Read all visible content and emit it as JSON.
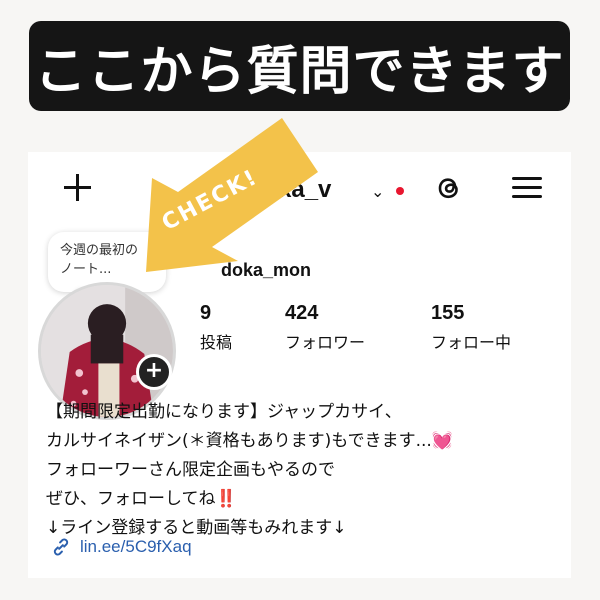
{
  "banner": {
    "text": "ここから質問できます"
  },
  "header": {
    "username": "ka_v",
    "chevron": "⌄",
    "icons": [
      "plus-icon",
      "threads-icon",
      "menu-icon"
    ]
  },
  "note": {
    "line1": "今週の最初の",
    "line2": "ノート..."
  },
  "profile": {
    "display_name": "doka_mon",
    "stats": [
      {
        "num": "9",
        "label": "投稿"
      },
      {
        "num": "424",
        "label": "フォロワー"
      },
      {
        "num": "155",
        "label": "フォロー中"
      }
    ]
  },
  "bio": {
    "line1": "【期間限定出勤になります】ジャップカサイ、",
    "line2": "カルサイネイザン(＊資格もあります)もできます...",
    "line2_emoji": "💓",
    "line3": "フォローワーさん限定企画もやるので",
    "line4": "ぜひ、フォローしてね",
    "line4_emoji": "‼️",
    "line5": "↓ライン登録すると動画等もみれます↓"
  },
  "link": {
    "text": "lin.ee/5C9fXaq"
  },
  "sticker": {
    "text": "CHECK!"
  },
  "colors": {
    "banner_bg": "#151515",
    "sticker": "#f3c24a",
    "link": "#2a5fae",
    "dot": "#e8162f"
  }
}
